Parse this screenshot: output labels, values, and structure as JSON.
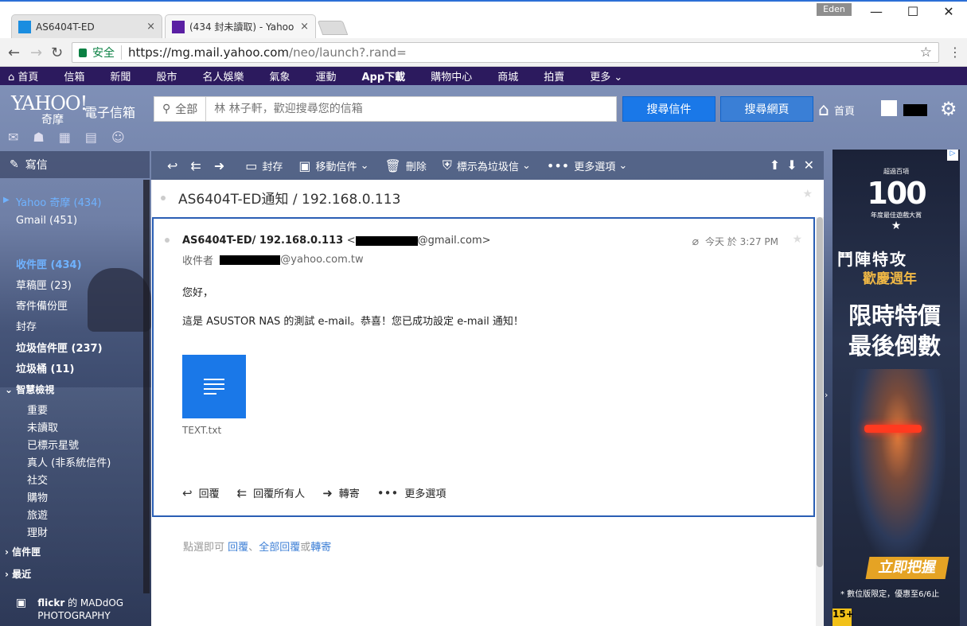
{
  "browser": {
    "tabs": [
      {
        "title": "AS6404T-ED",
        "close": "×"
      },
      {
        "title": "(434 封未讀取) - Yahoo",
        "close": "×"
      }
    ],
    "user_badge": "Eden",
    "secure_label": "安全",
    "url_host": "https://mg.mail.yahoo.com",
    "url_path": "/neo/launch?.rand=",
    "window": {
      "minimize": "—",
      "maximize": "☐",
      "close": "✕"
    }
  },
  "yahoo_nav": {
    "items": [
      "首頁",
      "信箱",
      "新聞",
      "股市",
      "名人娛樂",
      "氣象",
      "運動",
      "App下載",
      "購物中心",
      "商城",
      "拍賣",
      "更多"
    ]
  },
  "header": {
    "logo_text": "YAHOO!",
    "logo_sub": "奇摩",
    "logo_mail": "電子信箱",
    "search_scope": "全部",
    "search_placeholder": "林 林子軒，歡迎搜尋您的信箱",
    "search_mail_btn": "搜尋信件",
    "search_web_btn": "搜尋網頁",
    "home_label": "首頁"
  },
  "sidebar": {
    "compose": "寫信",
    "accounts": [
      {
        "label": "Yahoo 奇摩 (434)"
      },
      {
        "label": "Gmail (451)"
      }
    ],
    "folders": [
      {
        "label": "收件匣 (434)"
      },
      {
        "label": "草稿匣 (23)"
      },
      {
        "label": "寄件備份匣"
      },
      {
        "label": "封存"
      },
      {
        "label": "垃圾信件匣 (237)"
      },
      {
        "label": "垃圾桶 (11)"
      }
    ],
    "smart_views_title": "智慧檢視",
    "smart_views": [
      "重要",
      "未讀取",
      "已標示星號",
      "真人 (非系統信件)",
      "社交",
      "購物",
      "旅遊",
      "理財"
    ],
    "folders_title": "信件匣",
    "recent_title": "最近",
    "flickr_label": "flickr",
    "flickr_credit": "的 MADdOG PHOTOGRAPHY"
  },
  "toolbar": {
    "archive": "封存",
    "move": "移動信件",
    "delete": "刪除",
    "spam": "標示為垃圾信",
    "more": "更多選項"
  },
  "message": {
    "subject": "AS6404T-ED通知 / 192.168.0.113",
    "sender_name": "AS6404T-ED/ 192.168.0.113",
    "sender_email_open": "<",
    "sender_email_domain": "@gmail.com>",
    "date": "今天 於 3:27 PM",
    "to_label": "收件者",
    "to_domain": "@yahoo.com.tw",
    "greeting": "您好，",
    "body": "這是 ASUSTOR NAS 的測試 e-mail。恭喜！您已成功設定 e-mail 通知！",
    "attachment_name": "TEXT.txt",
    "actions": {
      "reply": "回覆",
      "reply_all": "回覆所有人",
      "forward": "轉寄",
      "more": "更多選項"
    },
    "hint_prefix": "點選即可",
    "hint_reply": "回覆",
    "hint_sep": "、",
    "hint_reply_all": "全部回覆",
    "hint_or": "或",
    "hint_forward": "轉寄"
  },
  "ad": {
    "badge_top": "超過百項",
    "badge_number": "100",
    "badge_bottom": "年度最佳遊戲大賞",
    "title": "鬥陣特攻",
    "subtitle": "歡慶週年",
    "headline1": "限時特價",
    "headline2": "最後倒數",
    "cta": "立即把握",
    "note": "* 數位版限定，優惠至6/6止",
    "rating": "15+"
  }
}
